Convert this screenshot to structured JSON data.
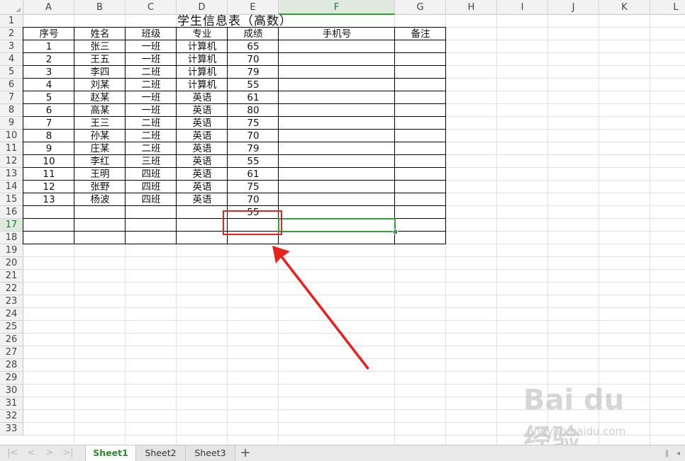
{
  "columns": [
    "A",
    "B",
    "C",
    "D",
    "E",
    "F",
    "G",
    "H",
    "I",
    "J",
    "K",
    "L"
  ],
  "rows": [
    "1",
    "2",
    "3",
    "4",
    "5",
    "6",
    "7",
    "8",
    "9",
    "10",
    "11",
    "12",
    "13",
    "14",
    "15",
    "16",
    "17",
    "18",
    "19",
    "20",
    "21",
    "22",
    "23",
    "24",
    "25",
    "26",
    "27",
    "28",
    "29",
    "30",
    "31",
    "32",
    "33"
  ],
  "active_column": "F",
  "active_row": "17",
  "title": "学生信息表（高数）",
  "headers": [
    "序号",
    "姓名",
    "班级",
    "专业",
    "成绩",
    "手机号",
    "备注"
  ],
  "records": [
    [
      "1",
      "张三",
      "一班",
      "计算机",
      "65"
    ],
    [
      "2",
      "王五",
      "一班",
      "计算机",
      "70"
    ],
    [
      "3",
      "李四",
      "二班",
      "计算机",
      "79"
    ],
    [
      "4",
      "刘某",
      "二班",
      "计算机",
      "55"
    ],
    [
      "5",
      "赵某",
      "一班",
      "英语",
      "61"
    ],
    [
      "6",
      "高某",
      "一班",
      "英语",
      "80"
    ],
    [
      "7",
      "王三",
      "二班",
      "英语",
      "75"
    ],
    [
      "8",
      "孙某",
      "二班",
      "英语",
      "70"
    ],
    [
      "9",
      "庄某",
      "二班",
      "英语",
      "79"
    ],
    [
      "10",
      "李红",
      "三班",
      "英语",
      "55"
    ],
    [
      "11",
      "王明",
      "四班",
      "英语",
      "61"
    ],
    [
      "12",
      "张野",
      "四班",
      "英语",
      "75"
    ],
    [
      "13",
      "杨波",
      "四班",
      "英语",
      "70"
    ]
  ],
  "extra_score": "55",
  "sheets": [
    "Sheet1",
    "Sheet2",
    "Sheet3"
  ],
  "active_sheet": "Sheet1",
  "add_sheet_symbol": "+",
  "nav_icons": [
    "first-sheet-icon",
    "prev-sheet-icon",
    "next-sheet-icon",
    "last-sheet-icon"
  ],
  "watermark": {
    "brand": "Bai du 经验",
    "url": "jingyan.baidu.com"
  },
  "colors": {
    "selection": "#2f9e3e",
    "annotation": "#e8221b",
    "header_bg": "#f2f2f2",
    "active_header_bg": "#dfe9dd"
  }
}
